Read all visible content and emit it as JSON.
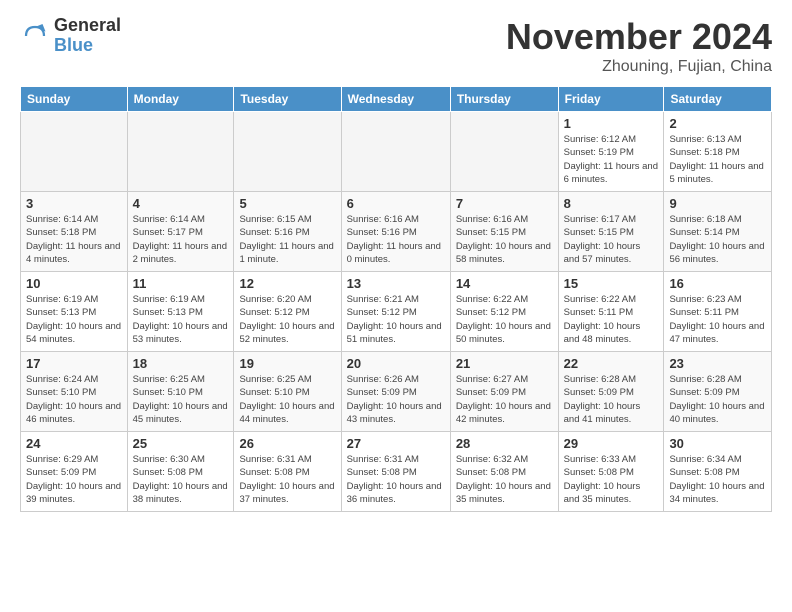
{
  "logo": {
    "general": "General",
    "blue": "Blue"
  },
  "title": "November 2024",
  "location": "Zhouning, Fujian, China",
  "weekdays": [
    "Sunday",
    "Monday",
    "Tuesday",
    "Wednesday",
    "Thursday",
    "Friday",
    "Saturday"
  ],
  "weeks": [
    [
      {
        "day": "",
        "info": ""
      },
      {
        "day": "",
        "info": ""
      },
      {
        "day": "",
        "info": ""
      },
      {
        "day": "",
        "info": ""
      },
      {
        "day": "",
        "info": ""
      },
      {
        "day": "1",
        "info": "Sunrise: 6:12 AM\nSunset: 5:19 PM\nDaylight: 11 hours and 6 minutes."
      },
      {
        "day": "2",
        "info": "Sunrise: 6:13 AM\nSunset: 5:18 PM\nDaylight: 11 hours and 5 minutes."
      }
    ],
    [
      {
        "day": "3",
        "info": "Sunrise: 6:14 AM\nSunset: 5:18 PM\nDaylight: 11 hours and 4 minutes."
      },
      {
        "day": "4",
        "info": "Sunrise: 6:14 AM\nSunset: 5:17 PM\nDaylight: 11 hours and 2 minutes."
      },
      {
        "day": "5",
        "info": "Sunrise: 6:15 AM\nSunset: 5:16 PM\nDaylight: 11 hours and 1 minute."
      },
      {
        "day": "6",
        "info": "Sunrise: 6:16 AM\nSunset: 5:16 PM\nDaylight: 11 hours and 0 minutes."
      },
      {
        "day": "7",
        "info": "Sunrise: 6:16 AM\nSunset: 5:15 PM\nDaylight: 10 hours and 58 minutes."
      },
      {
        "day": "8",
        "info": "Sunrise: 6:17 AM\nSunset: 5:15 PM\nDaylight: 10 hours and 57 minutes."
      },
      {
        "day": "9",
        "info": "Sunrise: 6:18 AM\nSunset: 5:14 PM\nDaylight: 10 hours and 56 minutes."
      }
    ],
    [
      {
        "day": "10",
        "info": "Sunrise: 6:19 AM\nSunset: 5:13 PM\nDaylight: 10 hours and 54 minutes."
      },
      {
        "day": "11",
        "info": "Sunrise: 6:19 AM\nSunset: 5:13 PM\nDaylight: 10 hours and 53 minutes."
      },
      {
        "day": "12",
        "info": "Sunrise: 6:20 AM\nSunset: 5:12 PM\nDaylight: 10 hours and 52 minutes."
      },
      {
        "day": "13",
        "info": "Sunrise: 6:21 AM\nSunset: 5:12 PM\nDaylight: 10 hours and 51 minutes."
      },
      {
        "day": "14",
        "info": "Sunrise: 6:22 AM\nSunset: 5:12 PM\nDaylight: 10 hours and 50 minutes."
      },
      {
        "day": "15",
        "info": "Sunrise: 6:22 AM\nSunset: 5:11 PM\nDaylight: 10 hours and 48 minutes."
      },
      {
        "day": "16",
        "info": "Sunrise: 6:23 AM\nSunset: 5:11 PM\nDaylight: 10 hours and 47 minutes."
      }
    ],
    [
      {
        "day": "17",
        "info": "Sunrise: 6:24 AM\nSunset: 5:10 PM\nDaylight: 10 hours and 46 minutes."
      },
      {
        "day": "18",
        "info": "Sunrise: 6:25 AM\nSunset: 5:10 PM\nDaylight: 10 hours and 45 minutes."
      },
      {
        "day": "19",
        "info": "Sunrise: 6:25 AM\nSunset: 5:10 PM\nDaylight: 10 hours and 44 minutes."
      },
      {
        "day": "20",
        "info": "Sunrise: 6:26 AM\nSunset: 5:09 PM\nDaylight: 10 hours and 43 minutes."
      },
      {
        "day": "21",
        "info": "Sunrise: 6:27 AM\nSunset: 5:09 PM\nDaylight: 10 hours and 42 minutes."
      },
      {
        "day": "22",
        "info": "Sunrise: 6:28 AM\nSunset: 5:09 PM\nDaylight: 10 hours and 41 minutes."
      },
      {
        "day": "23",
        "info": "Sunrise: 6:28 AM\nSunset: 5:09 PM\nDaylight: 10 hours and 40 minutes."
      }
    ],
    [
      {
        "day": "24",
        "info": "Sunrise: 6:29 AM\nSunset: 5:09 PM\nDaylight: 10 hours and 39 minutes."
      },
      {
        "day": "25",
        "info": "Sunrise: 6:30 AM\nSunset: 5:08 PM\nDaylight: 10 hours and 38 minutes."
      },
      {
        "day": "26",
        "info": "Sunrise: 6:31 AM\nSunset: 5:08 PM\nDaylight: 10 hours and 37 minutes."
      },
      {
        "day": "27",
        "info": "Sunrise: 6:31 AM\nSunset: 5:08 PM\nDaylight: 10 hours and 36 minutes."
      },
      {
        "day": "28",
        "info": "Sunrise: 6:32 AM\nSunset: 5:08 PM\nDaylight: 10 hours and 35 minutes."
      },
      {
        "day": "29",
        "info": "Sunrise: 6:33 AM\nSunset: 5:08 PM\nDaylight: 10 hours and 35 minutes."
      },
      {
        "day": "30",
        "info": "Sunrise: 6:34 AM\nSunset: 5:08 PM\nDaylight: 10 hours and 34 minutes."
      }
    ]
  ]
}
